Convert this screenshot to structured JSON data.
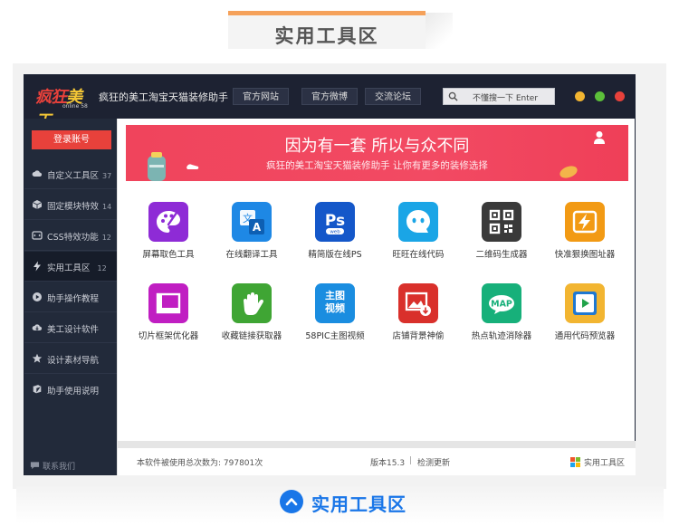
{
  "section": {
    "title": "实用工具区"
  },
  "app": {
    "title": "疯狂的美工淘宝天猫装修助手",
    "logo": {
      "main_a": "疯狂",
      "main_b": "美工",
      "sub": "online 58"
    },
    "nav": [
      "官方网站",
      "官方微博",
      "交流论坛"
    ],
    "search": {
      "placeholder": "不懂搜一下 Enter"
    },
    "window_controls": [
      {
        "name": "minimize",
        "color": "#f2b531"
      },
      {
        "name": "maximize",
        "color": "#5cbf3a"
      },
      {
        "name": "close",
        "color": "#e8413b"
      }
    ]
  },
  "sidebar": {
    "login": "登录账号",
    "items": [
      {
        "label": "自定义工具区",
        "count": "37",
        "icon": "cloud-icon"
      },
      {
        "label": "固定模块特效",
        "count": "14",
        "icon": "cube-icon"
      },
      {
        "label": "CSS特效功能",
        "count": "12",
        "icon": "css-icon"
      },
      {
        "label": "实用工具区",
        "count": "12",
        "icon": "lightning-icon",
        "active": true
      },
      {
        "label": "助手操作教程",
        "count": "",
        "icon": "play-icon"
      },
      {
        "label": "美工设计软件",
        "count": "",
        "icon": "cloud-download-icon"
      },
      {
        "label": "设计素材导航",
        "count": "",
        "icon": "star-icon"
      },
      {
        "label": "助手使用说明",
        "count": "",
        "icon": "book-icon"
      }
    ],
    "contact": "联系我们"
  },
  "banner": {
    "title": "因为有一套 所以与众不同",
    "subtitle": "疯狂的美工淘宝天猫装修助手 让你有更多的装修选择"
  },
  "tools": [
    {
      "label": "屏幕取色工具",
      "icon": "palette-icon",
      "color": "#8e2bd6"
    },
    {
      "label": "在线翻译工具",
      "icon": "translate-icon",
      "color": "#1e88e5"
    },
    {
      "label": "精简版在线PS",
      "icon": "photoshop-icon",
      "color": "#1457c9",
      "text": "Ps",
      "subtext": "web"
    },
    {
      "label": "旺旺在线代码",
      "icon": "wangwang-icon",
      "color": "#1aa5e6"
    },
    {
      "label": "二维码生成器",
      "icon": "qrcode-icon",
      "color": "#3a3a3a"
    },
    {
      "label": "快准狠换图址器",
      "icon": "lightning-image-icon",
      "color": "#f29a14"
    },
    {
      "label": "切片框架优化器",
      "icon": "frame-icon",
      "color": "#c01ec2"
    },
    {
      "label": "收藏链接获取器",
      "icon": "hand-icon",
      "color": "#3fa534"
    },
    {
      "label": "58PIC主图视频",
      "icon": "video-text-icon",
      "color": "#1a8de0",
      "text": "主图视频"
    },
    {
      "label": "店铺背景神偷",
      "icon": "image-download-icon",
      "color": "#d9302b"
    },
    {
      "label": "热点轨迹消除器",
      "icon": "map-icon",
      "color": "#17b07a",
      "text": "MAP"
    },
    {
      "label": "通用代码预览器",
      "icon": "preview-icon",
      "color": "#f2b531"
    }
  ],
  "status": {
    "usage": "本软件被使用总次数为: 797801次",
    "version": "版本15.3",
    "divider": "|",
    "update": "检测更新",
    "section": "实用工具区"
  },
  "caption": {
    "text": "实用工具区"
  }
}
